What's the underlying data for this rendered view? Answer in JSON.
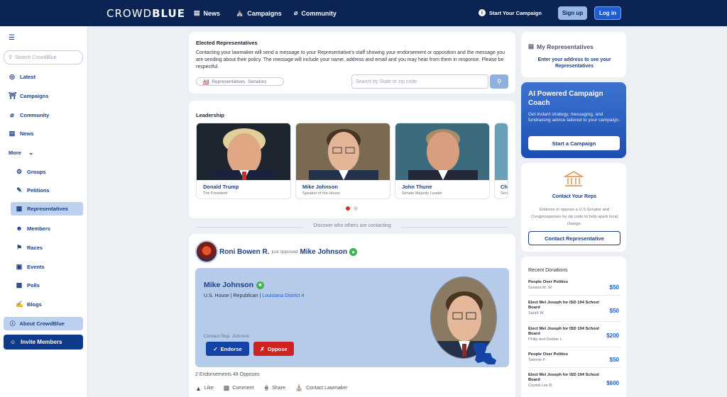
{
  "header": {
    "logo_light": "CROWD",
    "logo_bold": "BLUE",
    "nav": [
      {
        "label": "News",
        "icon": "newspaper-icon"
      },
      {
        "label": "Campaigns",
        "icon": "campaign-icon"
      },
      {
        "label": "Community",
        "icon": "community-icon"
      }
    ],
    "start_campaign": "Start Your Campaign",
    "signup": "Sign up",
    "login": "Log in"
  },
  "sidebar": {
    "search_placeholder": "Search CrowdBlue",
    "items": [
      {
        "label": "Latest"
      },
      {
        "label": "Campaigns"
      },
      {
        "label": "Community"
      },
      {
        "label": "News"
      },
      {
        "label": "More"
      }
    ],
    "sub_items": [
      {
        "label": "Groups"
      },
      {
        "label": "Petitions"
      },
      {
        "label": "Representatives"
      },
      {
        "label": "Members"
      },
      {
        "label": "Races"
      },
      {
        "label": "Events"
      },
      {
        "label": "Polls"
      },
      {
        "label": "Blogs"
      }
    ],
    "about": "About CrowdBlue",
    "invite": "Invite Members"
  },
  "elected": {
    "title": "Elected Representatives",
    "text": "Contacting your lawmaker will send a message to your Representative's staff showing your endorsement or opposition and the message you are sending about their policy. The message will include your name, address and email and you may hear from them in response. Please be respectful.",
    "tab_all": "All",
    "tab_reps": "Representatives",
    "tab_senators": "Senators",
    "search_placeholder": "Search by State or zip code"
  },
  "leadership": {
    "title": "Leadership",
    "cards": [
      {
        "name": "Donald Trump",
        "role": "The President"
      },
      {
        "name": "Mike Johnson",
        "role": "Speaker of the House"
      },
      {
        "name": "John Thune",
        "role": "Senate Majority Leader"
      },
      {
        "name": "Ch",
        "role": "Sen"
      }
    ]
  },
  "discover": "Discover who others are contacting",
  "post": {
    "author": "Roni Bowen R.",
    "action": "just opposed",
    "target": "Mike Johnson",
    "rep_name": "Mike Johnson",
    "rep_meta": "U.S. House | Republican |",
    "rep_district": "Louisiana District 4",
    "contact": "Contact Rep. Johnson",
    "endorse": "Endorse",
    "oppose": "Oppose",
    "stats": "2 Endorsements 48 Opposes",
    "actions": [
      "Like",
      "Comment",
      "Share",
      "Contact Lawmaker"
    ]
  },
  "right": {
    "my_reps_title": "My Representatives",
    "my_reps_text": "Enter your address to see your Representatives",
    "coach_title": "AI Powered Campaign Coach",
    "coach_text": "Get instant strategy, messaging, and fundraising advice tailored to your campaign.",
    "coach_btn": "Start a Campaign",
    "contact_title": "Contact Your Reps",
    "contact_text": "Endorse or oppose a U.S Senator and Congressperson by zip code to help spark local change.",
    "contact_btn": "Contact Representative",
    "donations_title": "Recent Donations",
    "donations": [
      {
        "name": "People Over Politics",
        "donor": "Susana M. W.",
        "amount": "$50"
      },
      {
        "name": "Elect Mel Joseph for ISD 194 School Board",
        "donor": "Sarah W.",
        "amount": "$50"
      },
      {
        "name": "Elect Mel Joseph for ISD 194 School Board",
        "donor": "Philip and Debbie L.",
        "amount": "$200"
      },
      {
        "name": "People Over Politics",
        "donor": "Tammie F.",
        "amount": "$50"
      },
      {
        "name": "Elect Mel Joseph for ISD 194 School Board",
        "donor": "Crystal Lee B.",
        "amount": "$600"
      }
    ]
  },
  "colors": {
    "navy": "#0c2454",
    "brand_blue": "#1f5ed1",
    "accent_red": "#d02222",
    "light_blue": "#b6cbea"
  }
}
